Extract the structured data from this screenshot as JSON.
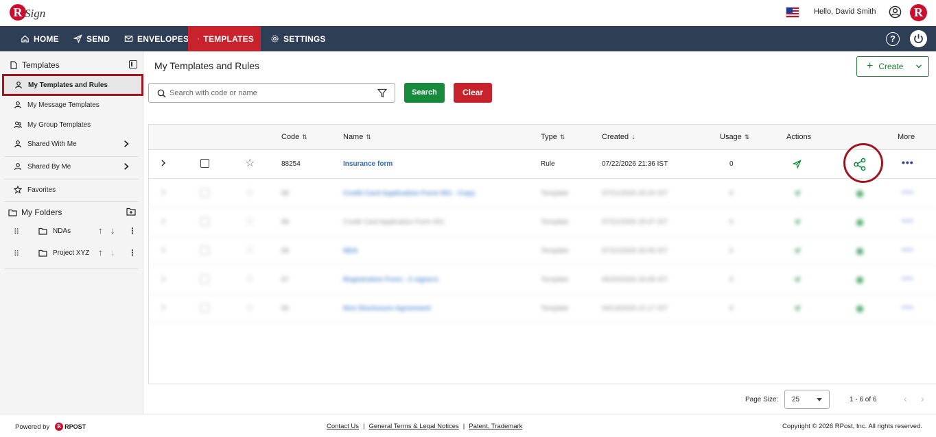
{
  "brand": {
    "sign_text": "Sign",
    "logo_letter": "R"
  },
  "header": {
    "greeting": "Hello, David Smith",
    "brand_letter": "R"
  },
  "nav": {
    "items": [
      {
        "label": "HOME",
        "icon": "home-icon"
      },
      {
        "label": "SEND",
        "icon": "send-icon"
      },
      {
        "label": "ENVELOPES",
        "icon": "envelope-icon"
      },
      {
        "label": "TEMPLATES",
        "icon": "document-icon",
        "active": true
      },
      {
        "label": "SETTINGS",
        "icon": "gear-icon"
      }
    ],
    "help_glyph": "?"
  },
  "sidebar": {
    "title": "Templates",
    "items": [
      {
        "label": "My Templates and Rules",
        "icon": "user-icon",
        "active": true
      },
      {
        "label": "My Message Templates",
        "icon": "user-icon"
      },
      {
        "label": "My Group Templates",
        "icon": "users-icon"
      },
      {
        "label": "Shared With Me",
        "icon": "user-icon",
        "has_chevron": true
      },
      {
        "label": "Shared By Me",
        "icon": "user-icon",
        "has_chevron": true
      },
      {
        "label": "Favorites",
        "icon": "star-icon"
      }
    ],
    "folders_title": "My Folders",
    "folders": [
      {
        "name": "NDAs"
      },
      {
        "name": "Project XYZ"
      }
    ]
  },
  "main": {
    "title": "My Templates and Rules",
    "create_label": "Create",
    "search": {
      "placeholder": "Search with code or name",
      "value": ""
    },
    "search_button": "Search",
    "clear_button": "Clear"
  },
  "table": {
    "columns": [
      "Code",
      "Name",
      "Type",
      "Created",
      "Usage",
      "Actions",
      "More"
    ],
    "rows": [
      {
        "code": "88254",
        "name": "Insurance form",
        "type": "Rule",
        "created": "07/22/2026 21:36 IST",
        "usage": "0"
      },
      {
        "code": "88",
        "name": "Credit Card Application Form 001 - Copy",
        "type": "Template",
        "created": "07/21/2026 20:24 IST",
        "usage": "0"
      },
      {
        "code": "88",
        "name": "Credit Card Application Form 001",
        "type": "Template",
        "created": "07/21/2026 20:07 IST",
        "usage": "0"
      },
      {
        "code": "88",
        "name": "NDA",
        "type": "Template",
        "created": "07/21/2026 20:05 IST",
        "usage": "0"
      },
      {
        "code": "87",
        "name": "Registration Form - 2 signers",
        "type": "Template",
        "created": "05/20/2026 20:08 IST",
        "usage": "0"
      },
      {
        "code": "85",
        "name": "Non Disclosure Agreement",
        "type": "Template",
        "created": "04/14/2026 21:17 IST",
        "usage": "0"
      }
    ]
  },
  "pagination": {
    "page_size_label": "Page Size:",
    "page_size": "25",
    "range": "1 - 6 of 6"
  },
  "footer": {
    "powered_by": "Powered by",
    "rpost": "RPOST",
    "links": [
      "Contact Us",
      "General Terms & Legal Notices",
      "Patent, Trademark"
    ],
    "separator": "|",
    "copyright": "Copyright © 2026 RPost, Inc. All rights reserved."
  },
  "colors": {
    "nav_bg": "#2d3e55",
    "active_red": "#c8232c",
    "green": "#178a3c",
    "link_blue": "#2a6cc2"
  }
}
